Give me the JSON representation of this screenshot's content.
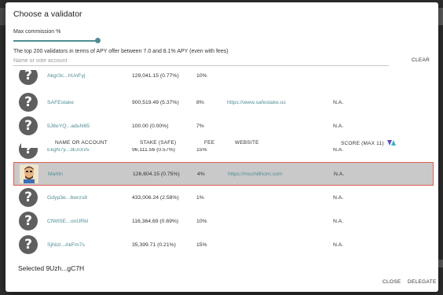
{
  "dialog": {
    "title": "Choose a validator",
    "commission_label": "Max commission %",
    "commission_level_fraction": 1.0,
    "apy_note": "The top 200 validators in terms of APY offer between 7.0 and 8.1% APY (even with fees)",
    "search": {
      "placeholder": "Name or vote account",
      "value": ""
    },
    "clear_label": "CLEAR",
    "columns": {
      "name": "NAME OR ACCOUNT",
      "stake": "STAKE (SAFE)",
      "fee": "FEE",
      "website": "WEBSITE",
      "score": "SCORE (MAX 11)"
    },
    "score_icon": "validators-app-logo-icon",
    "rows": [
      {
        "avatar": "question-mark-icon",
        "name": "Akgr3c...hUnFyj",
        "stake": "129,041.15 (0.77%)",
        "fee": "10%",
        "website": "",
        "score": ""
      },
      {
        "avatar": "question-mark-icon",
        "name": "SAFEstake",
        "stake": "900,519.49 (5.37%)",
        "fee": "8%",
        "website": "https://www.safestake.us",
        "score": "N.A."
      },
      {
        "avatar": "question-mark-icon",
        "name": "5J8eYQ...aduN65",
        "stake": "100.00 (0.00%)",
        "fee": "7%",
        "website": "",
        "score": "N.A."
      },
      {
        "avatar": "question-mark-icon",
        "name": "EkgN7y...3EAXv5",
        "stake": "96,111.56 (0.57%)",
        "fee": "15%",
        "website": "",
        "score": "N.A."
      },
      {
        "avatar": "memoji-avatar-icon",
        "name": "Martin",
        "stake": "126,604.15 (0.75%)",
        "fee": "4%",
        "website": "https://mschillhorn.com",
        "score": "N.A."
      },
      {
        "avatar": "question-mark-icon",
        "name": "Gdyp3e...bwrzs8",
        "stake": "433,006.24 (2.58%)",
        "fee": "1%",
        "website": "",
        "score": "N.A."
      },
      {
        "avatar": "question-mark-icon",
        "name": "CfWtSE...onURkl",
        "stake": "116,364.69 (0.69%)",
        "fee": "10%",
        "website": "",
        "score": "N.A."
      },
      {
        "avatar": "question-mark-icon",
        "name": "SjNizi...AkFm7s",
        "stake": "35,399.71 (0.21%)",
        "fee": "15%",
        "website": "",
        "score": "N.A."
      }
    ],
    "selected_row_index": 4,
    "selected_text": "Selected 9Uzh...gC7H",
    "close_label": "CLOSE",
    "delegate_label": "DELEGATE"
  },
  "colors": {
    "accent_teal": "#4f8f97",
    "selected_row_bg": "#c9c9c9",
    "selected_row_border": "#e05a4f",
    "avatar_bg": "#5f5f5f"
  }
}
